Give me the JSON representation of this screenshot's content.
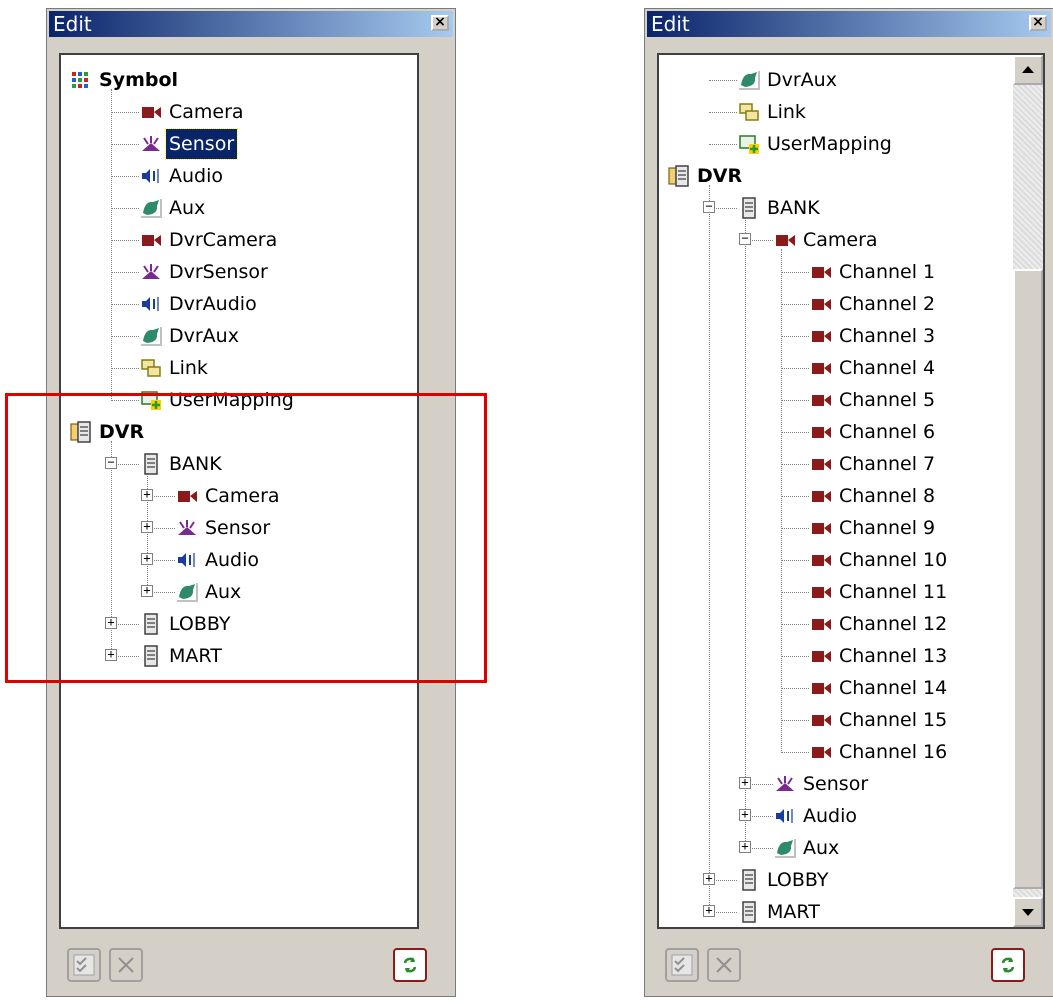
{
  "left_panel": {
    "title": "Edit",
    "tree": [
      {
        "label": "Symbol",
        "icon": "symbol-icon",
        "level": 0,
        "bold": true
      },
      {
        "label": "Camera",
        "icon": "camera-icon",
        "level": 1
      },
      {
        "label": "Sensor",
        "icon": "sensor-icon",
        "level": 1,
        "selected": true
      },
      {
        "label": "Audio",
        "icon": "audio-icon",
        "level": 1
      },
      {
        "label": "Aux",
        "icon": "aux-icon",
        "level": 1
      },
      {
        "label": "DvrCamera",
        "icon": "camera-icon",
        "level": 1
      },
      {
        "label": "DvrSensor",
        "icon": "sensor-icon",
        "level": 1
      },
      {
        "label": "DvrAudio",
        "icon": "audio-icon",
        "level": 1
      },
      {
        "label": "DvrAux",
        "icon": "aux-icon",
        "level": 1
      },
      {
        "label": "Link",
        "icon": "link-icon",
        "level": 1
      },
      {
        "label": "UserMapping",
        "icon": "usermapping-icon",
        "level": 1
      },
      {
        "label": "DVR",
        "icon": "dvr-icon",
        "level": 0,
        "bold": true
      },
      {
        "label": "BANK",
        "icon": "server-icon",
        "level": 1,
        "expander": "-"
      },
      {
        "label": "Camera",
        "icon": "camera-icon",
        "level": 2,
        "expander": "+"
      },
      {
        "label": "Sensor",
        "icon": "sensor-icon",
        "level": 2,
        "expander": "+"
      },
      {
        "label": "Audio",
        "icon": "audio-icon",
        "level": 2,
        "expander": "+"
      },
      {
        "label": "Aux",
        "icon": "aux-icon",
        "level": 2,
        "expander": "+"
      },
      {
        "label": "LOBBY",
        "icon": "server-icon",
        "level": 1,
        "expander": "+"
      },
      {
        "label": "MART",
        "icon": "server-icon",
        "level": 1,
        "expander": "+"
      }
    ]
  },
  "right_panel": {
    "title": "Edit",
    "tree": [
      {
        "label": "DvrAux",
        "icon": "aux-icon",
        "level": 1
      },
      {
        "label": "Link",
        "icon": "link-icon",
        "level": 1
      },
      {
        "label": "UserMapping",
        "icon": "usermapping-icon",
        "level": 1
      },
      {
        "label": "DVR",
        "icon": "dvr-icon",
        "level": 0,
        "bold": true
      },
      {
        "label": "BANK",
        "icon": "server-icon",
        "level": 1,
        "expander": "-"
      },
      {
        "label": "Camera",
        "icon": "camera-icon",
        "level": 2,
        "expander": "-"
      },
      {
        "label": "Channel 1",
        "icon": "camera-icon",
        "level": 3
      },
      {
        "label": "Channel 2",
        "icon": "camera-icon",
        "level": 3
      },
      {
        "label": "Channel 3",
        "icon": "camera-icon",
        "level": 3
      },
      {
        "label": "Channel 4",
        "icon": "camera-icon",
        "level": 3
      },
      {
        "label": "Channel 5",
        "icon": "camera-icon",
        "level": 3
      },
      {
        "label": "Channel 6",
        "icon": "camera-icon",
        "level": 3
      },
      {
        "label": "Channel 7",
        "icon": "camera-icon",
        "level": 3
      },
      {
        "label": "Channel 8",
        "icon": "camera-icon",
        "level": 3
      },
      {
        "label": "Channel 9",
        "icon": "camera-icon",
        "level": 3
      },
      {
        "label": "Channel 10",
        "icon": "camera-icon",
        "level": 3
      },
      {
        "label": "Channel 11",
        "icon": "camera-icon",
        "level": 3
      },
      {
        "label": "Channel 12",
        "icon": "camera-icon",
        "level": 3
      },
      {
        "label": "Channel 13",
        "icon": "camera-icon",
        "level": 3
      },
      {
        "label": "Channel 14",
        "icon": "camera-icon",
        "level": 3
      },
      {
        "label": "Channel 15",
        "icon": "camera-icon",
        "level": 3
      },
      {
        "label": "Channel 16",
        "icon": "camera-icon",
        "level": 3
      },
      {
        "label": "Sensor",
        "icon": "sensor-icon",
        "level": 2,
        "expander": "+"
      },
      {
        "label": "Audio",
        "icon": "audio-icon",
        "level": 2,
        "expander": "+"
      },
      {
        "label": "Aux",
        "icon": "aux-icon",
        "level": 2,
        "expander": "+"
      },
      {
        "label": "LOBBY",
        "icon": "server-icon",
        "level": 1,
        "expander": "+"
      },
      {
        "label": "MART",
        "icon": "server-icon",
        "level": 1,
        "expander": "+"
      }
    ]
  },
  "buttons": {
    "apply_icon": "checklist-icon",
    "delete_icon": "delete-x-icon",
    "refresh_icon": "refresh-icon"
  },
  "colors": {
    "titlebar_start": "#0a246a",
    "titlebar_end": "#a6caf0",
    "camera": "#8b1a1a",
    "sensor": "#7b2a8f",
    "audio": "#1a3ca0",
    "aux": "#2f8a6a",
    "highlight": "#e00000"
  }
}
